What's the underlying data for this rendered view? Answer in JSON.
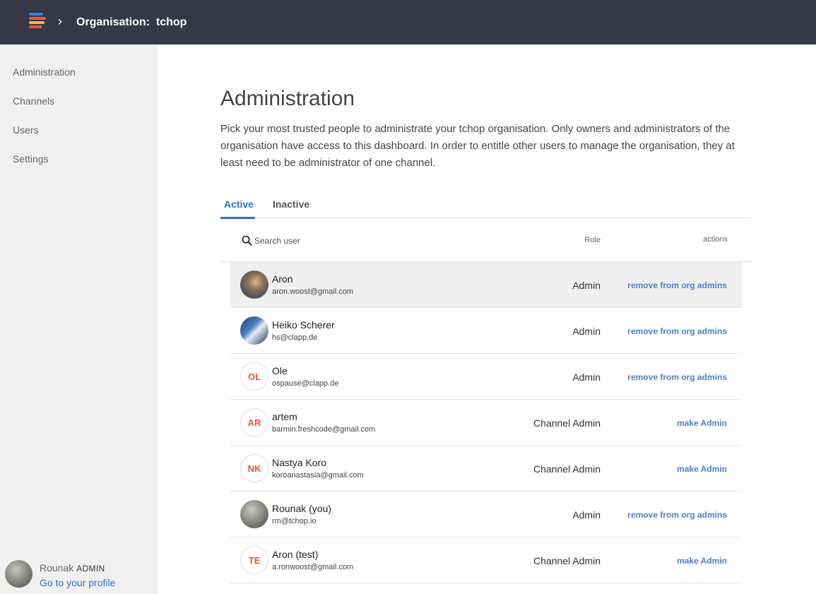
{
  "header": {
    "logo": "tchop-logo-icon",
    "breadcrumb_separator": "›",
    "title": "Organisation:  tchop",
    "logo_colors": [
      "#3b82d6",
      "#e85a3a",
      "#f5b82e",
      "#e8553a"
    ]
  },
  "sidebar": {
    "items": [
      {
        "label": "Administration"
      },
      {
        "label": "Channels"
      },
      {
        "label": "Users"
      },
      {
        "label": "Settings"
      }
    ],
    "profile": {
      "name": "Rounak",
      "role": "ADMIN",
      "link": "Go to your profile"
    }
  },
  "main": {
    "title": "Administration",
    "description": "Pick your most trusted people to administrate your tchop organisation. Only owners and administrators of the organisation have access to this dashboard. In order to entitle other users to manage the organisation, they at least need to be administrator of one channel.",
    "tabs": [
      {
        "label": "Active",
        "active": true
      },
      {
        "label": "Inactive",
        "active": false
      }
    ],
    "table": {
      "search_placeholder": "Search user",
      "header_role": "Role",
      "header_actions": "actions",
      "rows": [
        {
          "name": "Aron",
          "email": "aron.woost@gmail.com",
          "role": "Admin",
          "action": "remove from org admins",
          "avatar": "photo",
          "initials": ""
        },
        {
          "name": "Heiko Scherer",
          "email": "hs@clapp.de",
          "role": "Admin",
          "action": "remove from org admins",
          "avatar": "photo",
          "initials": ""
        },
        {
          "name": "Ole",
          "email": "ospause@clapp.de",
          "role": "Admin",
          "action": "remove from org admins",
          "avatar": "initials",
          "initials": "OL"
        },
        {
          "name": "artem",
          "email": "barmin.freshcode@gmail.com",
          "role": "Channel Admin",
          "action": "make Admin",
          "avatar": "initials",
          "initials": "AR"
        },
        {
          "name": "Nastya Koro",
          "email": "koroanastasia@gmail.com",
          "role": "Channel Admin",
          "action": "make Admin",
          "avatar": "initials",
          "initials": "NK"
        },
        {
          "name": "Rounak (you)",
          "email": "rm@tchop.io",
          "role": "Admin",
          "action": "remove from org admins",
          "avatar": "photo",
          "initials": ""
        },
        {
          "name": "Aron (test)",
          "email": "a.ronwoost@gmail.com",
          "role": "Channel Admin",
          "action": "make Admin",
          "avatar": "initials",
          "initials": "TE"
        }
      ]
    }
  },
  "colors": {
    "topbar": "#363848",
    "accent": "#2f6fd6",
    "initials": "#e8553a"
  }
}
